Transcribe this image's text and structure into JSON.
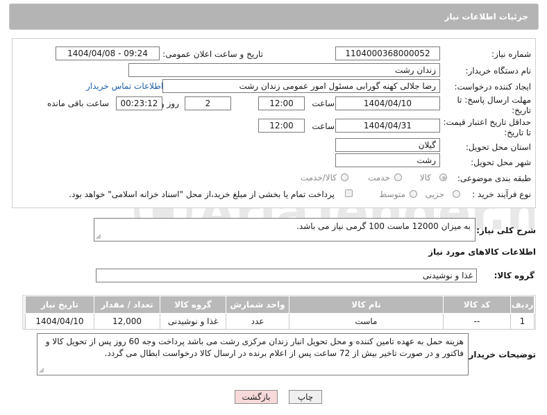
{
  "header": {
    "title": "جزئیات اطلاعات نیاز"
  },
  "form": {
    "need_number_label": "شماره نیاز:",
    "need_number_value": "1104000368000052",
    "announce_label": "تاریخ و ساعت اعلان عمومی:",
    "announce_value": "1404/04/08 - 09:24",
    "buyer_label": "نام دستگاه خریدار:",
    "buyer_value": "زندان رشت",
    "creator_label": "ایجاد کننده درخواست:",
    "creator_value": "رضا جلالی کهنه گورابی مسئول امور عمومی زندان رشت",
    "contact_link": "اطلاعات تماس خریدار",
    "deadline_label_1": "مهلت ارسال پاسخ: تا",
    "deadline_label_2": "تاریخ:",
    "deadline_date": "1404/04/10",
    "time_label": "ساعت",
    "deadline_time": "12:00",
    "days_value": "2",
    "days_label": "روز و",
    "remaining_value": "00:23:12",
    "remaining_label": "ساعت باقی مانده",
    "price_label_1": "حداقل تاریخ اعتبار قیمت:",
    "price_label_2": "تا تاریخ:",
    "price_date": "1404/04/31",
    "price_time": "12:00",
    "province_label": "استان محل تحویل:",
    "province_value": "گیلان",
    "city_label": "شهر محل تحویل:",
    "city_value": "رشت",
    "category_label": "طبقه بندی موضوعی:",
    "category_options": [
      "کالا",
      "خدمت",
      "کالا/خدمت"
    ],
    "process_label": "نوع فرآیند خرید :",
    "process_options": [
      "جزیی",
      "متوسط"
    ],
    "payment_note": "پرداخت تمام یا بخشی از مبلغ خرید،از محل \"اسناد خزانه اسلامی\" خواهد بود."
  },
  "description": {
    "label": "شرح کلی نیاز:",
    "value": "به میزان 12000 ماست 100 گرمی نیاز می باشد."
  },
  "goods": {
    "section_title": "اطلاعات کالاهای مورد نیاز",
    "group_label": "گروه کالا:",
    "group_value": "غذا و نوشیدنی",
    "columns": [
      "ردیف",
      "کد کالا",
      "نام کالا",
      "واحد شمارش",
      "گروه کالا",
      "تعداد / مقدار",
      "تاریخ نیاز"
    ],
    "rows": [
      [
        "1",
        "--",
        "ماست",
        "عدد",
        "غذا و نوشیدنی",
        "12,000",
        "1404/04/10"
      ]
    ]
  },
  "notes": {
    "label": "توضیحات خریدار:",
    "value": "هزینه حمل به عهده تامین کننده و محل تحویل انبار زندان مرکزی رشت می باشد پرداخت وجه 60 روز پس از تحویل کالا و فاکتور و در صورت تاخیر بیش از 72 ساعت پس از اعلام برنده در ارسال کالا درخواست ابطال می گردد."
  },
  "buttons": {
    "print": "چاپ",
    "back": "بازگشت"
  },
  "watermark": {
    "text": "AriaTender.neT"
  }
}
